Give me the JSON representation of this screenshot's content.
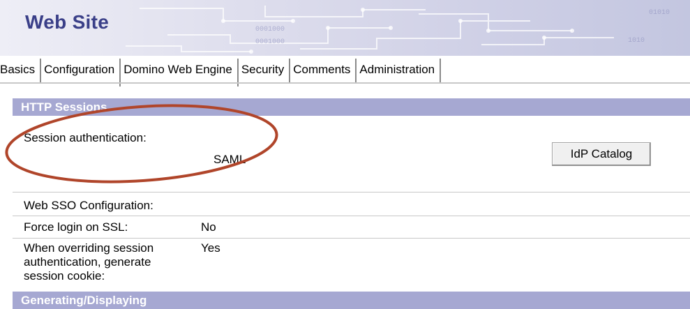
{
  "header": {
    "title": "Web Site"
  },
  "tabs": [
    {
      "label": "Basics"
    },
    {
      "label": "Configuration"
    },
    {
      "label": "Domino Web Engine"
    },
    {
      "label": "Security"
    },
    {
      "label": "Comments"
    },
    {
      "label": "Administration"
    }
  ],
  "active_tab": "Domino Web Engine",
  "sections": {
    "http_sessions": "HTTP Sessions",
    "next_section": "Generating/Displaying"
  },
  "fields": {
    "session_auth": {
      "label": "Session authentication:",
      "value": "SAML"
    },
    "web_sso": {
      "label": "Web SSO Configuration:",
      "value": ""
    },
    "force_login": {
      "label": "Force login on SSL:",
      "value": "No"
    },
    "override_cookie": {
      "label_line1": "When overriding session",
      "label_line2": "authentication, generate",
      "label_line3": "session cookie:",
      "value": "Yes"
    }
  },
  "buttons": {
    "idp_catalog": "IdP Catalog"
  },
  "colors": {
    "title": "#3a3f88",
    "section_header_bg": "#a6a8d2",
    "annotation_ellipse": "#b0452a"
  }
}
